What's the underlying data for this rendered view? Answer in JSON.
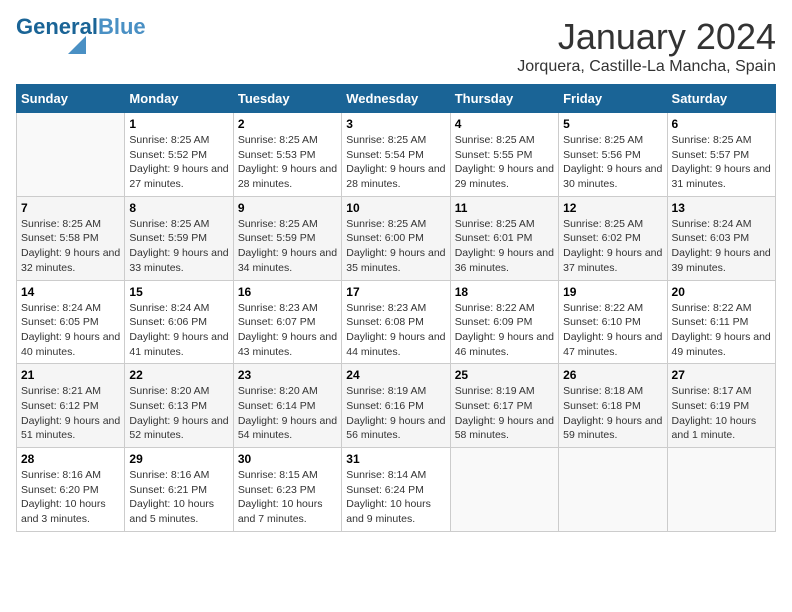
{
  "logo": {
    "part1": "General",
    "part2": "Blue"
  },
  "title": "January 2024",
  "subtitle": "Jorquera, Castille-La Mancha, Spain",
  "weekdays": [
    "Sunday",
    "Monday",
    "Tuesday",
    "Wednesday",
    "Thursday",
    "Friday",
    "Saturday"
  ],
  "weeks": [
    [
      {
        "day": "",
        "sunrise": "",
        "sunset": "",
        "daylight": ""
      },
      {
        "day": "1",
        "sunrise": "Sunrise: 8:25 AM",
        "sunset": "Sunset: 5:52 PM",
        "daylight": "Daylight: 9 hours and 27 minutes."
      },
      {
        "day": "2",
        "sunrise": "Sunrise: 8:25 AM",
        "sunset": "Sunset: 5:53 PM",
        "daylight": "Daylight: 9 hours and 28 minutes."
      },
      {
        "day": "3",
        "sunrise": "Sunrise: 8:25 AM",
        "sunset": "Sunset: 5:54 PM",
        "daylight": "Daylight: 9 hours and 28 minutes."
      },
      {
        "day": "4",
        "sunrise": "Sunrise: 8:25 AM",
        "sunset": "Sunset: 5:55 PM",
        "daylight": "Daylight: 9 hours and 29 minutes."
      },
      {
        "day": "5",
        "sunrise": "Sunrise: 8:25 AM",
        "sunset": "Sunset: 5:56 PM",
        "daylight": "Daylight: 9 hours and 30 minutes."
      },
      {
        "day": "6",
        "sunrise": "Sunrise: 8:25 AM",
        "sunset": "Sunset: 5:57 PM",
        "daylight": "Daylight: 9 hours and 31 minutes."
      }
    ],
    [
      {
        "day": "7",
        "sunrise": "Sunrise: 8:25 AM",
        "sunset": "Sunset: 5:58 PM",
        "daylight": "Daylight: 9 hours and 32 minutes."
      },
      {
        "day": "8",
        "sunrise": "Sunrise: 8:25 AM",
        "sunset": "Sunset: 5:59 PM",
        "daylight": "Daylight: 9 hours and 33 minutes."
      },
      {
        "day": "9",
        "sunrise": "Sunrise: 8:25 AM",
        "sunset": "Sunset: 5:59 PM",
        "daylight": "Daylight: 9 hours and 34 minutes."
      },
      {
        "day": "10",
        "sunrise": "Sunrise: 8:25 AM",
        "sunset": "Sunset: 6:00 PM",
        "daylight": "Daylight: 9 hours and 35 minutes."
      },
      {
        "day": "11",
        "sunrise": "Sunrise: 8:25 AM",
        "sunset": "Sunset: 6:01 PM",
        "daylight": "Daylight: 9 hours and 36 minutes."
      },
      {
        "day": "12",
        "sunrise": "Sunrise: 8:25 AM",
        "sunset": "Sunset: 6:02 PM",
        "daylight": "Daylight: 9 hours and 37 minutes."
      },
      {
        "day": "13",
        "sunrise": "Sunrise: 8:24 AM",
        "sunset": "Sunset: 6:03 PM",
        "daylight": "Daylight: 9 hours and 39 minutes."
      }
    ],
    [
      {
        "day": "14",
        "sunrise": "Sunrise: 8:24 AM",
        "sunset": "Sunset: 6:05 PM",
        "daylight": "Daylight: 9 hours and 40 minutes."
      },
      {
        "day": "15",
        "sunrise": "Sunrise: 8:24 AM",
        "sunset": "Sunset: 6:06 PM",
        "daylight": "Daylight: 9 hours and 41 minutes."
      },
      {
        "day": "16",
        "sunrise": "Sunrise: 8:23 AM",
        "sunset": "Sunset: 6:07 PM",
        "daylight": "Daylight: 9 hours and 43 minutes."
      },
      {
        "day": "17",
        "sunrise": "Sunrise: 8:23 AM",
        "sunset": "Sunset: 6:08 PM",
        "daylight": "Daylight: 9 hours and 44 minutes."
      },
      {
        "day": "18",
        "sunrise": "Sunrise: 8:22 AM",
        "sunset": "Sunset: 6:09 PM",
        "daylight": "Daylight: 9 hours and 46 minutes."
      },
      {
        "day": "19",
        "sunrise": "Sunrise: 8:22 AM",
        "sunset": "Sunset: 6:10 PM",
        "daylight": "Daylight: 9 hours and 47 minutes."
      },
      {
        "day": "20",
        "sunrise": "Sunrise: 8:22 AM",
        "sunset": "Sunset: 6:11 PM",
        "daylight": "Daylight: 9 hours and 49 minutes."
      }
    ],
    [
      {
        "day": "21",
        "sunrise": "Sunrise: 8:21 AM",
        "sunset": "Sunset: 6:12 PM",
        "daylight": "Daylight: 9 hours and 51 minutes."
      },
      {
        "day": "22",
        "sunrise": "Sunrise: 8:20 AM",
        "sunset": "Sunset: 6:13 PM",
        "daylight": "Daylight: 9 hours and 52 minutes."
      },
      {
        "day": "23",
        "sunrise": "Sunrise: 8:20 AM",
        "sunset": "Sunset: 6:14 PM",
        "daylight": "Daylight: 9 hours and 54 minutes."
      },
      {
        "day": "24",
        "sunrise": "Sunrise: 8:19 AM",
        "sunset": "Sunset: 6:16 PM",
        "daylight": "Daylight: 9 hours and 56 minutes."
      },
      {
        "day": "25",
        "sunrise": "Sunrise: 8:19 AM",
        "sunset": "Sunset: 6:17 PM",
        "daylight": "Daylight: 9 hours and 58 minutes."
      },
      {
        "day": "26",
        "sunrise": "Sunrise: 8:18 AM",
        "sunset": "Sunset: 6:18 PM",
        "daylight": "Daylight: 9 hours and 59 minutes."
      },
      {
        "day": "27",
        "sunrise": "Sunrise: 8:17 AM",
        "sunset": "Sunset: 6:19 PM",
        "daylight": "Daylight: 10 hours and 1 minute."
      }
    ],
    [
      {
        "day": "28",
        "sunrise": "Sunrise: 8:16 AM",
        "sunset": "Sunset: 6:20 PM",
        "daylight": "Daylight: 10 hours and 3 minutes."
      },
      {
        "day": "29",
        "sunrise": "Sunrise: 8:16 AM",
        "sunset": "Sunset: 6:21 PM",
        "daylight": "Daylight: 10 hours and 5 minutes."
      },
      {
        "day": "30",
        "sunrise": "Sunrise: 8:15 AM",
        "sunset": "Sunset: 6:23 PM",
        "daylight": "Daylight: 10 hours and 7 minutes."
      },
      {
        "day": "31",
        "sunrise": "Sunrise: 8:14 AM",
        "sunset": "Sunset: 6:24 PM",
        "daylight": "Daylight: 10 hours and 9 minutes."
      },
      {
        "day": "",
        "sunrise": "",
        "sunset": "",
        "daylight": ""
      },
      {
        "day": "",
        "sunrise": "",
        "sunset": "",
        "daylight": ""
      },
      {
        "day": "",
        "sunrise": "",
        "sunset": "",
        "daylight": ""
      }
    ]
  ]
}
